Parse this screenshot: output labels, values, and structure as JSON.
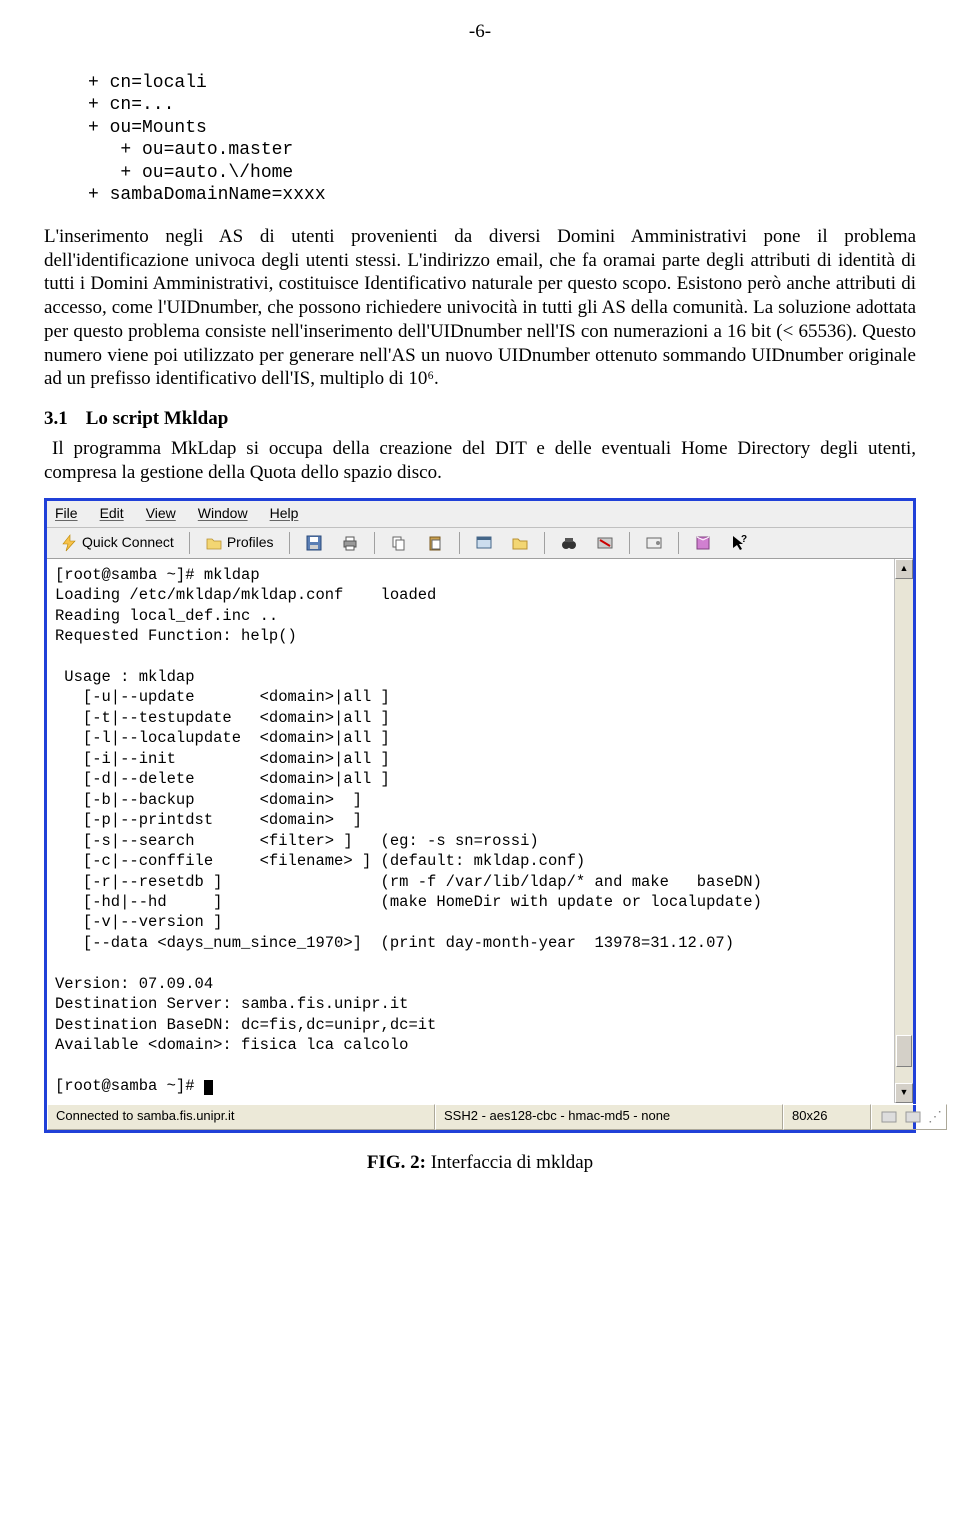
{
  "page_number": "-6-",
  "code_block": "+ cn=locali\n+ cn=...\n+ ou=Mounts\n   + ou=auto.master\n   + ou=auto.\\/home\n+ sambaDomainName=xxxx",
  "paragraph": "L'inserimento negli AS di utenti provenienti da diversi Domini Amministrativi pone il problema dell'identificazione univoca degli utenti stessi. L'indirizzo email, che fa oramai parte degli attributi di identità di tutti i Domini Amministrativi, costituisce Identificativo naturale per questo scopo. Esistono però anche attributi di accesso, come l'UIDnumber, che possono richiedere univocità in tutti gli AS della comunità. La soluzione adottata per questo problema consiste nell'inserimento dell'UIDnumber nell'IS con numerazioni a 16 bit (< 65536). Questo numero viene poi utilizzato per generare nell'AS un nuovo UIDnumber ottenuto sommando UIDnumber originale ad un prefisso identificativo dell'IS, multiplo di 10⁶.",
  "section": {
    "num": "3.1",
    "title": "Lo script Mkldap"
  },
  "section_text": "Il programma MkLdap si occupa della creazione del DIT e delle eventuali Home Directory degli utenti, compresa la gestione della Quota dello spazio disco.",
  "screenshot": {
    "menubar": [
      "File",
      "Edit",
      "View",
      "Window",
      "Help"
    ],
    "toolbar": {
      "quick_connect": "Quick Connect",
      "profiles": "Profiles"
    },
    "terminal_output": "[root@samba ~]# mkldap\nLoading /etc/mkldap/mkldap.conf    loaded\nReading local_def.inc ..\nRequested Function: help()\n\n Usage : mkldap\n   [-u|--update       <domain>|all ]\n   [-t|--testupdate   <domain>|all ]\n   [-l|--localupdate  <domain>|all ]\n   [-i|--init         <domain>|all ]\n   [-d|--delete       <domain>|all ]\n   [-b|--backup       <domain>  ]\n   [-p|--printdst     <domain>  ]\n   [-s|--search       <filter> ]   (eg: -s sn=rossi)\n   [-c|--conffile     <filename> ] (default: mkldap.conf)\n   [-r|--resetdb ]                 (rm -f /var/lib/ldap/* and make   baseDN)\n   [-hd|--hd     ]                 (make HomeDir with update or localupdate)\n   [-v|--version ]\n   [--data <days_num_since_1970>]  (print day-month-year  13978=31.12.07)\n\nVersion: 07.09.04\nDestination Server: samba.fis.unipr.it\nDestination BaseDN: dc=fis,dc=unipr,dc=it\nAvailable <domain>: fisica lca calcolo\n\n[root@samba ~]# ",
    "statusbar": {
      "c1": "Connected to samba.fis.unipr.it",
      "c2": "SSH2 - aes128-cbc - hmac-md5 - none",
      "c3": "80x26"
    }
  },
  "figure_caption_bold": "FIG. 2:",
  "figure_caption_rest": " Interfaccia di mkldap"
}
